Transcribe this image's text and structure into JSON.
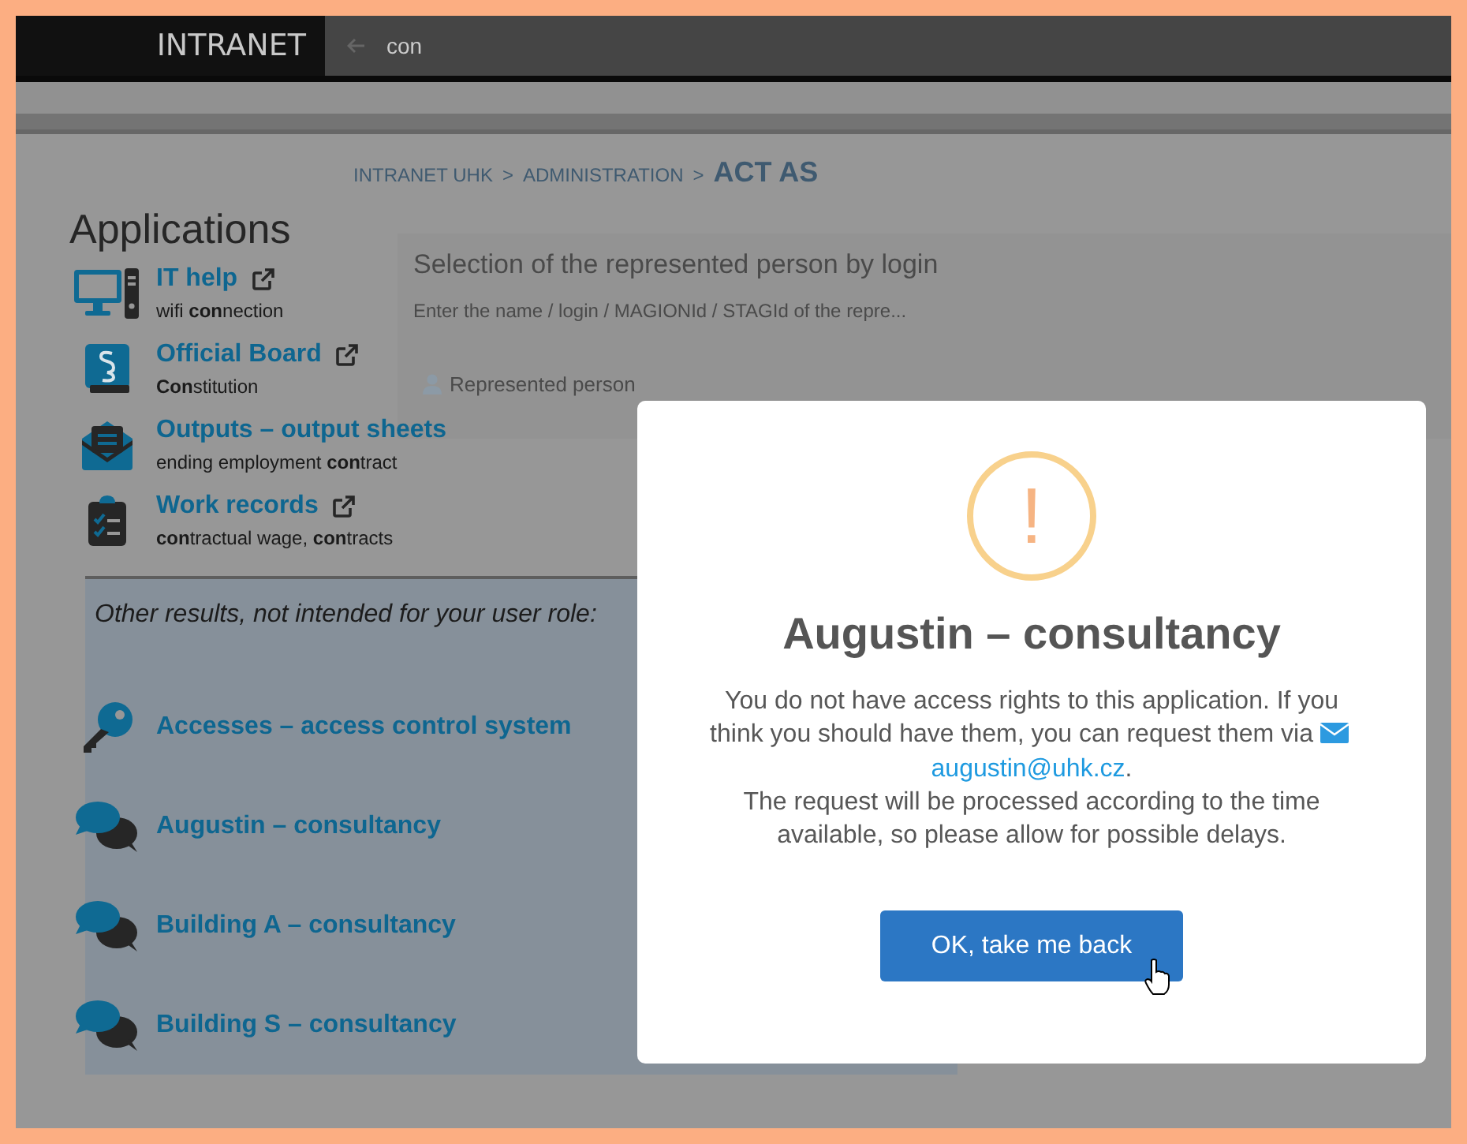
{
  "header": {
    "logo": "INTRANET",
    "search_value": "con"
  },
  "background": {
    "breadcrumb": [
      "INTRANET UHK",
      ">",
      "ADMINISTRATION",
      ">"
    ],
    "page_title": "ACT AS",
    "heading": "Selection of the represented person by login",
    "hint": "Enter the name / login / MAGIONId / STAGId of the repre...",
    "field_label": "Represented person"
  },
  "applications": {
    "title": "Applications",
    "items": [
      {
        "kind": "computer",
        "name": "IT help",
        "external": true,
        "subtitle": "wifi **con**nection"
      },
      {
        "kind": "book",
        "name": "Official Board",
        "external": true,
        "subtitle": "**Con**stitution"
      },
      {
        "kind": "envelope",
        "name": "Outputs – output sheets",
        "external": false,
        "subtitle": "ending employment **con**tract"
      },
      {
        "kind": "clipboard",
        "name": "Work records",
        "external": true,
        "subtitle": "**con**tractual wage, **con**tracts"
      }
    ],
    "other_title": "Other results, not intended for your user role:",
    "other_items": [
      {
        "kind": "key",
        "name": "Accesses – access control system"
      },
      {
        "kind": "chat",
        "name": "Augustin – consultancy"
      },
      {
        "kind": "chat",
        "name": "Building A – consultancy"
      },
      {
        "kind": "chat",
        "name": "Building S – consultancy"
      }
    ]
  },
  "dialog": {
    "icon": "!",
    "title": "Augustin – consultancy",
    "message_before": "You do not have access rights to this application. If you think you should have them, you can request them via",
    "email": "augustin@uhk.cz",
    "message_after": ".",
    "message_2": "The request will be processed according to the time available, so please allow for possible delays.",
    "button": "OK, take me back"
  }
}
